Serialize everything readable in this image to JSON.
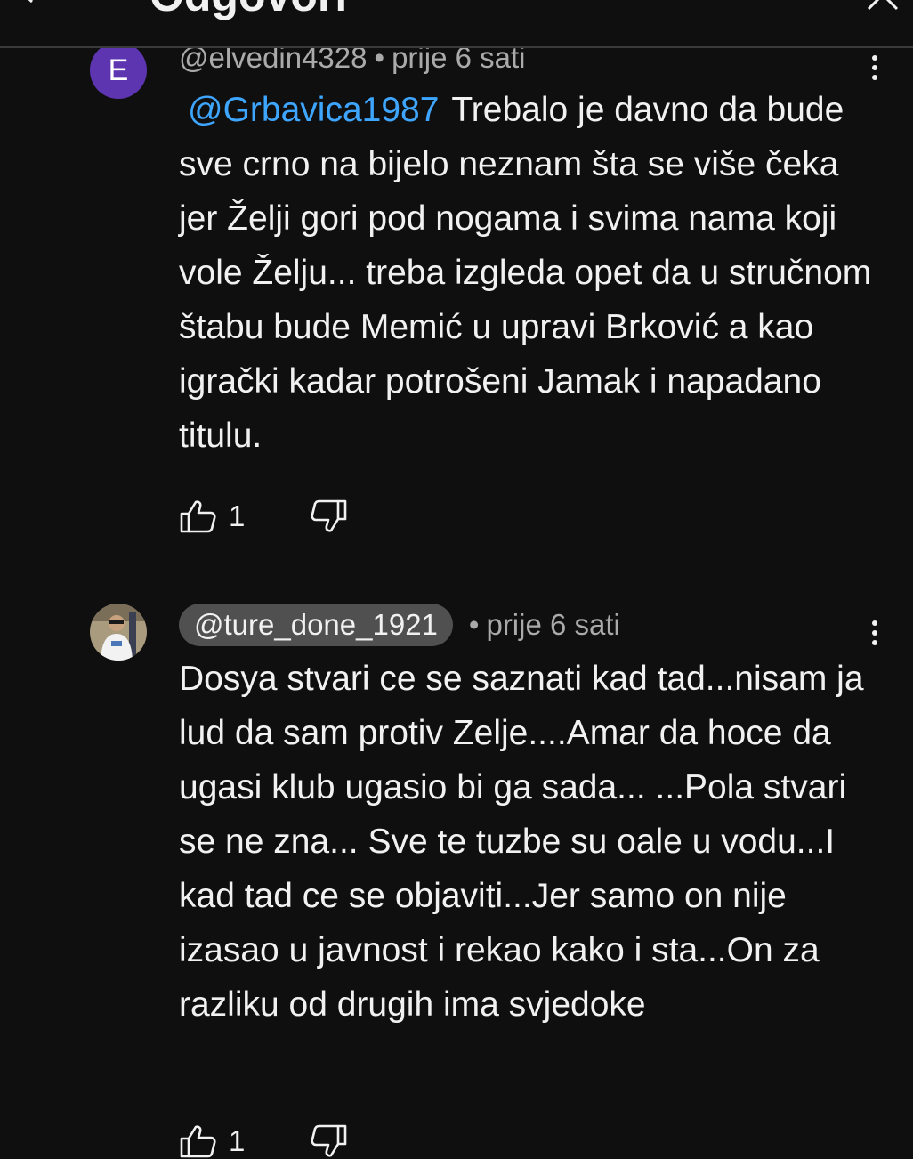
{
  "header": {
    "title": "Odgovori"
  },
  "comments": [
    {
      "avatar_letter": "E",
      "avatar_color": "#5e35b1",
      "handle": "@elvedin4328",
      "separator": "•",
      "time": "prije 6 sati",
      "mention": "@Grbavica1987",
      "text": "Trebalo je davno da bude sve crno na bijelo neznam šta se više čeka jer Želji gori pod nogama i svima nama koji vole Želju... treba izgleda opet da u stručnom štabu bude Memić u upravi Brković a kao igrački kadar potrošeni Jamak i napadano titulu.",
      "likes": "1"
    },
    {
      "avatar": "user-photo",
      "handle": "@ture_done_1921",
      "separator": "•",
      "time": "prije 6 sati",
      "text": "Dosya stvari ce se saznati kad tad...nisam ja lud da sam protiv Zelje....Amar da hoce da ugasi klub ugasio bi ga sada... ...Pola stvari se ne zna... Sve te tuzbe su oale u vodu...I kad tad ce se objaviti...Jer samo on nije izasao u javnost i rekao kako i sta...On za razliku od drugih ima svjedoke",
      "likes": "1"
    }
  ],
  "colors": {
    "background": "#0f0f0f",
    "text": "#f1f1f1",
    "muted": "#aaaaaa",
    "link": "#3ea6ff",
    "pill": "#505050"
  }
}
